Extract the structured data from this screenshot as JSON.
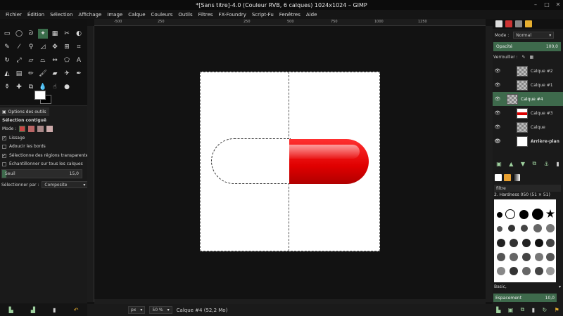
{
  "window": {
    "title": "*[Sans titre]-4.0 (Couleur RVB, 6 calques) 1024x1024 – GIMP"
  },
  "menu": [
    "Fichier",
    "Édition",
    "Sélection",
    "Affichage",
    "Image",
    "Calque",
    "Couleurs",
    "Outils",
    "Filtres",
    "FX-Foundry",
    "Script-Fu",
    "Fenêtres",
    "Aide"
  ],
  "tool_options": {
    "tab_label": "Options des outils",
    "title": "Sélection contiguë",
    "mode_label": "Mode :",
    "lissage": "Lissage",
    "adoucir": "Adoucir les bords",
    "transparent": "Sélectionne des régions transparentes",
    "sample_merged": "Échantillonner sur tous les calques",
    "seuil_label": "Seuil",
    "seuil_value": "15,0",
    "select_by_label": "Sélectionner par :",
    "select_by_value": "Composite"
  },
  "ruler": {
    "h_ticks": [
      "-500",
      "250",
      "250",
      "500",
      "750",
      "1000",
      "1250"
    ],
    "v_ticks": [
      "0",
      "2",
      "5",
      "0",
      "2",
      "5",
      "0",
      "5",
      "0",
      "7",
      "5",
      "0",
      "1",
      "0",
      "0",
      "1",
      "2",
      "5",
      "0"
    ]
  },
  "status": {
    "unit": "px",
    "zoom": "50 %",
    "info": "Calque #4 (52,2 Mo)"
  },
  "layers_panel": {
    "mode_label": "Mode :",
    "mode_value": "Normal",
    "opacity_label": "Opacité",
    "opacity_value": "100,0",
    "lock_label": "Verrouiller :",
    "layers": [
      {
        "name": "Calque #2"
      },
      {
        "name": "Calque #1"
      },
      {
        "name": "Calque #4"
      },
      {
        "name": "Calque #3"
      },
      {
        "name": "Calque"
      },
      {
        "name": "Arrière-plan"
      }
    ]
  },
  "brushes": {
    "filter": "filtre",
    "current": "2. Hardness 050 (51 × 51)",
    "preset": "Basic,",
    "spacing_label": "Espacement",
    "spacing_value": "10,0"
  }
}
